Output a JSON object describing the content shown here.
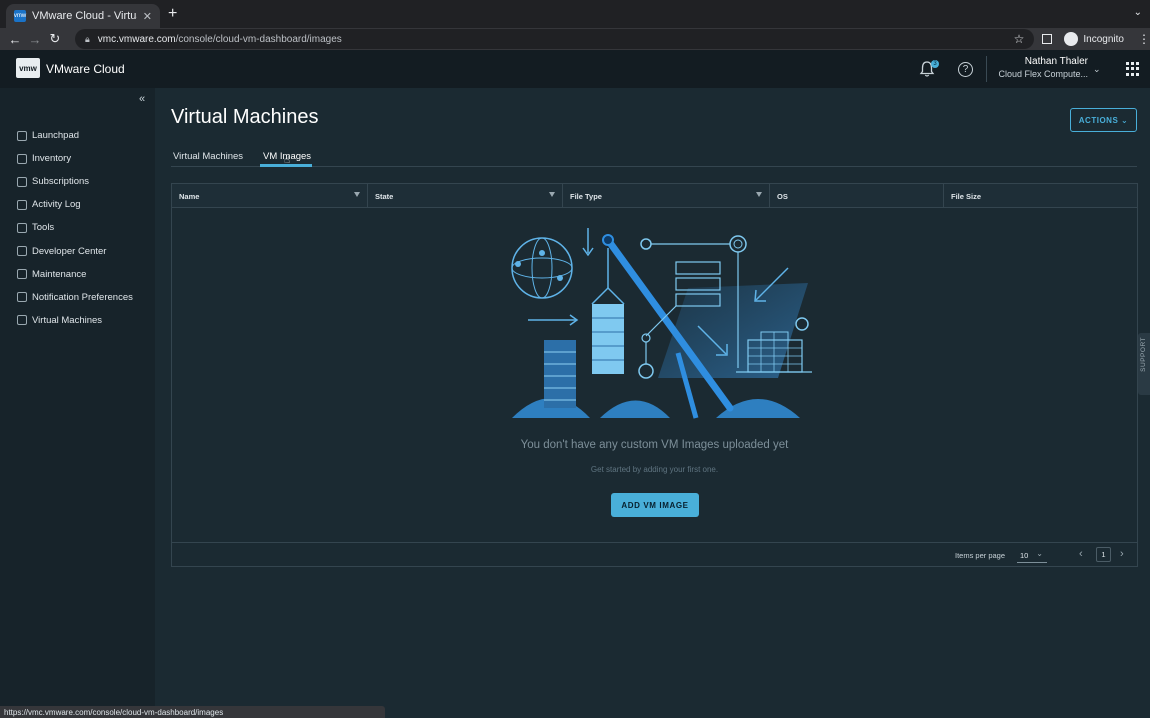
{
  "browser": {
    "tab_title": "VMware Cloud - Virtual Machi…",
    "favicon_text": "vmw",
    "url_host": "vmc.vmware.com",
    "url_path": "/console/cloud-vm-dashboard/images",
    "profile_label": "Incognito",
    "status_url": "https://vmc.vmware.com/console/cloud-vm-dashboard/images"
  },
  "header": {
    "logo_text": "vmw",
    "brand": "VMware Cloud",
    "notification_count": "3",
    "help_icon": "?",
    "user_name": "Nathan Thaler",
    "user_org": "Cloud Flex Compute..."
  },
  "sidebar": {
    "items": [
      {
        "label": "Launchpad",
        "icon": "rocket-icon"
      },
      {
        "label": "Inventory",
        "icon": "inventory-icon"
      },
      {
        "label": "Subscriptions",
        "icon": "calendar-icon"
      },
      {
        "label": "Activity Log",
        "icon": "list-icon"
      },
      {
        "label": "Tools",
        "icon": "briefcase-icon"
      },
      {
        "label": "Developer Center",
        "icon": "code-icon"
      },
      {
        "label": "Maintenance",
        "icon": "wrench-icon"
      },
      {
        "label": "Notification Preferences",
        "icon": "sliders-icon"
      },
      {
        "label": "Virtual Machines",
        "icon": "vm-icon"
      }
    ]
  },
  "main": {
    "title": "Virtual Machines",
    "actions_label": "ACTIONS",
    "tabs": [
      {
        "label": "Virtual Machines",
        "active": false
      },
      {
        "label": "VM Images",
        "active": true
      }
    ],
    "columns": [
      "Name",
      "State",
      "File Type",
      "OS",
      "File Size"
    ],
    "empty_message": "You don't have any custom VM Images uploaded yet",
    "empty_sub": "Get started by adding your first one.",
    "add_button": "ADD VM IMAGE",
    "items_per_page_label": "Items per page",
    "items_per_page_value": "10",
    "page": "1"
  },
  "support_label": "SUPPORT",
  "colors": {
    "accent": "#49afd9",
    "background": "#1b2a32",
    "header": "#131c22",
    "sidebar": "#17232a"
  }
}
